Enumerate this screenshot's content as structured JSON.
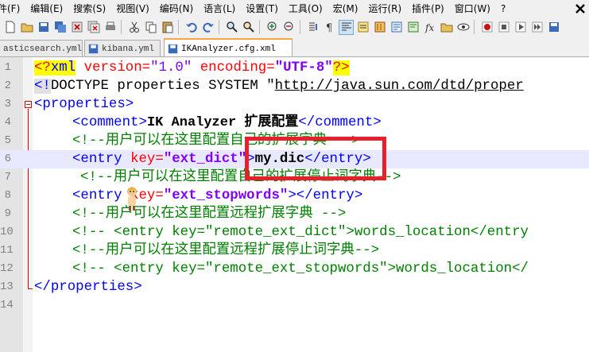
{
  "menu": [
    "件(F)",
    "编辑(E)",
    "搜索(S)",
    "视图(V)",
    "编码(N)",
    "语言(L)",
    "设置(T)",
    "工具(O)",
    "宏(M)",
    "运行(R)",
    "插件(P)",
    "窗口(W)",
    "?"
  ],
  "toolbar_icons": [
    "new-file-icon",
    "open-file-icon",
    "save-icon",
    "save-all-icon",
    "close-icon",
    "close-all-icon",
    "print-icon",
    "cut-icon",
    "copy-icon",
    "paste-icon",
    "undo-icon",
    "redo-icon",
    "find-icon",
    "replace-icon",
    "zoom-in-icon",
    "zoom-out-icon",
    "sync-vertical-icon",
    "sync-horizontal-icon",
    "word-wrap-icon",
    "show-all-chars-icon",
    "indent-guide-icon",
    "user-defined-lang-icon",
    "doc-map-icon",
    "function-list-icon",
    "folder-workspace-icon",
    "monitoring-icon",
    "record-macro-icon",
    "stop-record-icon",
    "play-macro-icon",
    "play-multiple-icon",
    "save-macro-icon"
  ],
  "tabs": [
    {
      "label": "asticsearch.yml",
      "icon": "saved-file-icon"
    },
    {
      "label": "kibana.yml",
      "icon": "saved-file-icon"
    },
    {
      "label": "IKAnalyzer.cfg.xml",
      "icon": "saved-file-icon"
    }
  ],
  "editor": {
    "line_numbers": [
      "1",
      "2",
      "3",
      "4",
      "5",
      "6",
      "7",
      "8",
      "9",
      "10",
      "11",
      "12",
      "13",
      "14"
    ],
    "current_line": "6",
    "tokens": {
      "l1": [
        "<?",
        "xml",
        " version=",
        "\"1.0\"",
        " encoding=",
        "\"UTF-8\"",
        "?>"
      ],
      "l2": [
        "<!",
        "DOCTYPE properties SYSTEM \"",
        "http://java.sun.com/dtd/proper"
      ],
      "l3": [
        "<properties>"
      ],
      "l4": [
        "<comment>",
        "IK Analyzer 扩展配置",
        "</comment>"
      ],
      "l5": [
        "<!--用户可以在这里配置自己的扩展字典 -->"
      ],
      "l6": [
        "<entry ",
        "key=",
        "\"ext_dict\"",
        ">",
        "my.dic",
        "</entry>"
      ],
      "l7": [
        "<!--用户可以在这里配置自己的扩展停止词字典-->"
      ],
      "l8": [
        "<entry ",
        "key=",
        "\"ext_stopwords\"",
        "></entry>"
      ],
      "l9": [
        "<!--用户可以在这里配置远程扩展字典 -->"
      ],
      "l10": [
        "<!-- <entry key=\"remote_ext_dict\">words_location</entry"
      ],
      "l11": [
        "<!--用户可以在这里配置远程扩展停止词字典-->"
      ],
      "l12": [
        "<!-- <entry key=\"remote_ext_stopwords\">words_location</"
      ],
      "l13": [
        "</properties>"
      ],
      "l14": [
        ""
      ]
    }
  },
  "colors": {
    "tag": "#0000ff",
    "attribute": "#ff0000",
    "value": "#8000ff",
    "comment": "#008000",
    "highlight_box": "#e8202c",
    "active_tab_accent": "#f9a743"
  }
}
